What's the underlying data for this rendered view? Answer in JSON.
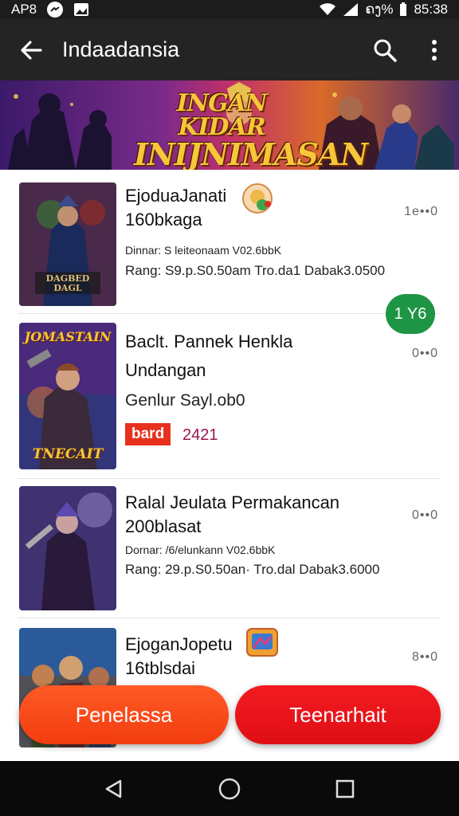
{
  "status_bar": {
    "carrier": "AP8",
    "battery": "ຄງ%",
    "time": "85:38"
  },
  "app_bar": {
    "title": "Indaadansia"
  },
  "banner": {
    "line1": "INGAN KIDAR",
    "line2": "INIJNIMASAN",
    "tagline": ""
  },
  "items": [
    {
      "title_line1": "EjoduaJanati",
      "title_line2": "160bkaga",
      "sub": "Dinnar: S leiteonaam V02.6bbK",
      "meta": "Rang: S9.p.S0.50am Tro.da1 Dabak3.0500",
      "more": "1e••0",
      "thumb_caption": "DAGBED DAGL"
    },
    {
      "title_line1": "Baclt. Pannek Henkla",
      "title_line2": "Undangan",
      "sub": "Genlur Sayl.ob0",
      "tag": "bard",
      "tag_num": "2421",
      "more": "0••0",
      "thumb_title": "JOMASTAIN",
      "thumb_caption": "TNECAIT"
    },
    {
      "title_line1": "Ralal Jeulata Permakancan",
      "title_line2": "200blasat",
      "sub": "Dornar: /6/elunkann V02.6bbK",
      "meta": "Rang: 29.p.S0.50an· Tro.dal Dabak3.6000",
      "more": "0••0"
    },
    {
      "title_line1": "EjoganJopetu",
      "title_line2": "16tblsdai",
      "more": "8••0"
    }
  ],
  "floating_badge": "1 Y6",
  "actions": {
    "left": "Penelassa",
    "right": "Teenarhait"
  },
  "colors": {
    "app_bar": "#242424",
    "accent_orange": "#ff5a25",
    "accent_red": "#f41b22",
    "badge_green": "#1e9544"
  }
}
